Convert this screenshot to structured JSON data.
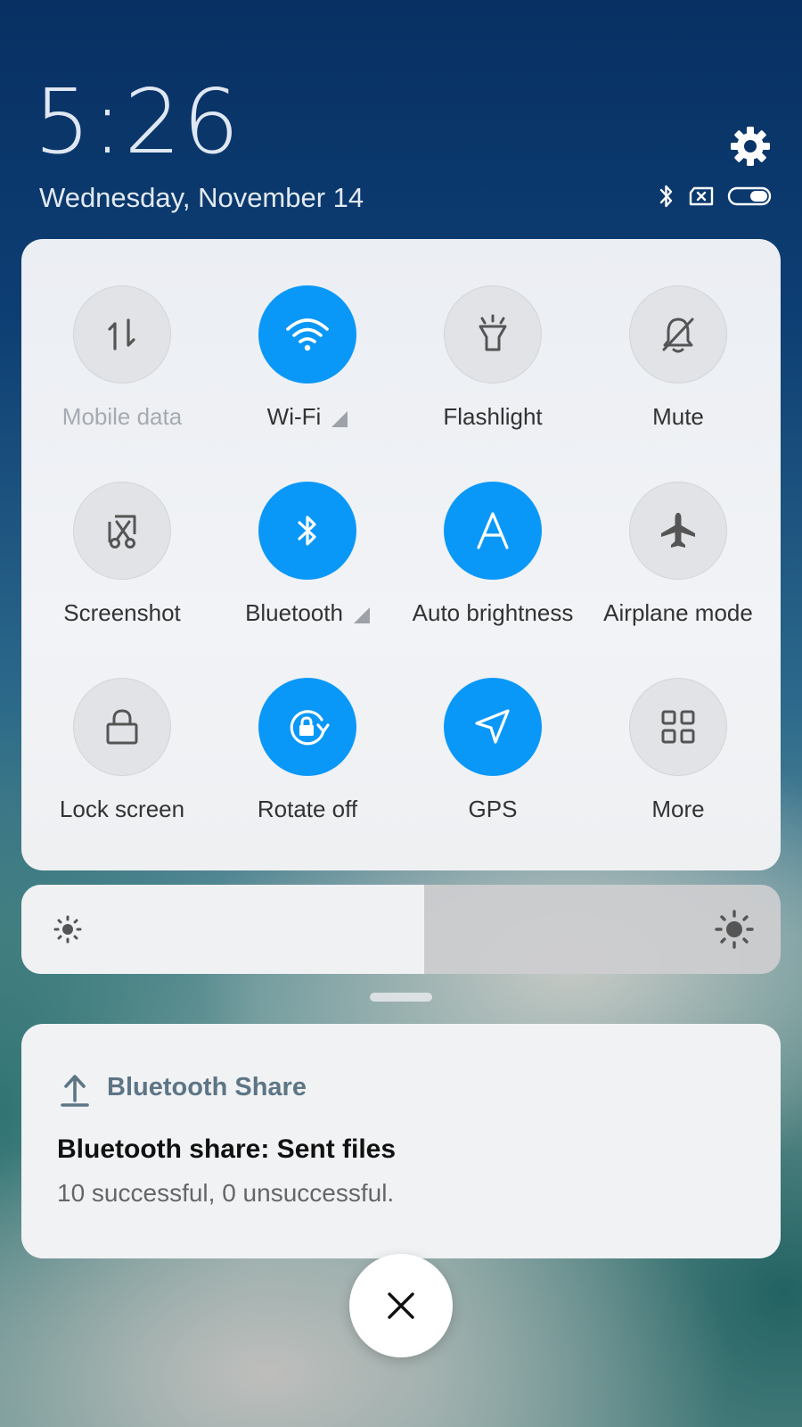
{
  "header": {
    "time": "5:26",
    "date": "Wednesday, November 14"
  },
  "icons": {
    "settings": "gear-icon",
    "status": [
      "bluetooth-icon",
      "no-sim-icon",
      "battery-icon"
    ]
  },
  "quick_settings": {
    "tiles": [
      {
        "label": "Mobile data",
        "icon": "mobile-data-icon",
        "active": false,
        "disabled": true
      },
      {
        "label": "Wi-Fi",
        "icon": "wifi-icon",
        "active": true,
        "has_more": true
      },
      {
        "label": "Flashlight",
        "icon": "flashlight-icon",
        "active": false
      },
      {
        "label": "Mute",
        "icon": "mute-bell-icon",
        "active": false
      },
      {
        "label": "Screenshot",
        "icon": "screenshot-scissors-icon",
        "active": false
      },
      {
        "label": "Bluetooth",
        "icon": "bluetooth-icon",
        "active": true,
        "has_more": true
      },
      {
        "label": "Auto brightness",
        "icon": "auto-brightness-icon",
        "active": true
      },
      {
        "label": "Airplane mode",
        "icon": "airplane-icon",
        "active": false
      },
      {
        "label": "Lock screen",
        "icon": "lock-icon",
        "active": false
      },
      {
        "label": "Rotate off",
        "icon": "rotate-lock-icon",
        "active": true
      },
      {
        "label": "GPS",
        "icon": "gps-arrow-icon",
        "active": true
      },
      {
        "label": "More",
        "icon": "grid-icon",
        "active": false
      }
    ]
  },
  "brightness": {
    "level": 0.53,
    "icon_low": "sun-small-icon",
    "icon_high": "sun-large-icon"
  },
  "notification": {
    "app_icon": "upload-icon",
    "app_name": "Bluetooth Share",
    "title": "Bluetooth share: Sent files",
    "text": "10 successful, 0 unsuccessful."
  },
  "dismiss_icon": "close-icon",
  "colors": {
    "accent": "#0a98f8",
    "tile_off": "#e1e3e6",
    "notif_app_name": "#5d7585"
  }
}
